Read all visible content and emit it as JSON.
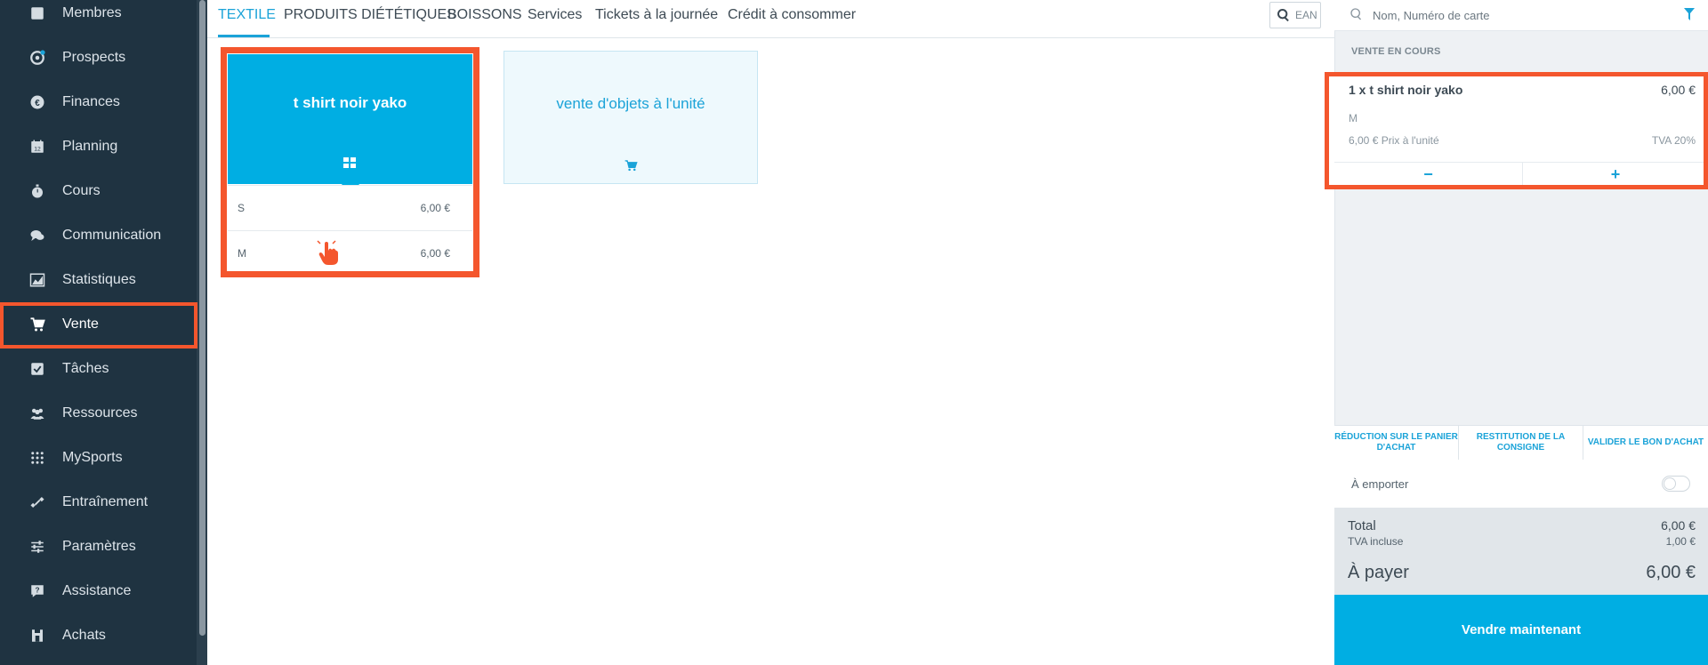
{
  "sidebar": {
    "items": [
      {
        "label": "Membres",
        "icon": "id-card-icon"
      },
      {
        "label": "Prospects",
        "icon": "target-icon"
      },
      {
        "label": "Finances",
        "icon": "euro-icon"
      },
      {
        "label": "Planning",
        "icon": "calendar-icon"
      },
      {
        "label": "Cours",
        "icon": "stopwatch-icon"
      },
      {
        "label": "Communication",
        "icon": "chat-icon"
      },
      {
        "label": "Statistiques",
        "icon": "chart-icon"
      },
      {
        "label": "Vente",
        "icon": "cart-icon"
      },
      {
        "label": "Tâches",
        "icon": "checkbox-icon"
      },
      {
        "label": "Ressources",
        "icon": "users-icon"
      },
      {
        "label": "MySports",
        "icon": "dots-grid-icon"
      },
      {
        "label": "Entraînement",
        "icon": "dumbbell-icon"
      },
      {
        "label": "Paramètres",
        "icon": "sliders-icon"
      },
      {
        "label": "Assistance",
        "icon": "help-icon"
      },
      {
        "label": "Achats",
        "icon": "store-icon"
      }
    ],
    "active": "Vente"
  },
  "tabs": [
    "TEXTILE",
    "PRODUITS DIÉTÉTIQUES",
    "BOISSONS",
    "Services",
    "Tickets à la journée",
    "Crédit à consommer"
  ],
  "active_tab": "TEXTILE",
  "ean_label": "EAN",
  "products": {
    "tile1": {
      "title": "t shirt noir yako",
      "variants": [
        {
          "name": "S",
          "price": "6,00 €"
        },
        {
          "name": "M",
          "price": "6,00 €"
        }
      ]
    },
    "tile2": {
      "title": "vente d'objets à l'unité"
    }
  },
  "right": {
    "search_placeholder": "Nom, Numéro de carte",
    "sale_heading": "VENTE EN COURS",
    "cart_item": {
      "name": "1 x t shirt noir yako",
      "price": "6,00 €",
      "size": "M",
      "unit_price": "6,00 € Prix à l'unité",
      "tva": "TVA 20%",
      "minus": "−",
      "plus": "+"
    },
    "actions": [
      "RÉDUCTION SUR LE PANIER D'ACHAT",
      "RESTITUTION DE LA CONSIGNE",
      "VALIDER LE BON D'ACHAT"
    ],
    "takeaway_label": "À emporter",
    "totals": {
      "total_label": "Total",
      "total_value": "6,00 €",
      "tva_label": "TVA incluse",
      "tva_value": "1,00 €",
      "pay_label": "À payer",
      "pay_value": "6,00 €"
    },
    "sell_button": "Vendre maintenant"
  },
  "colors": {
    "accent": "#00aee3",
    "highlight": "#f4562d",
    "sidebar": "#1f3341"
  }
}
